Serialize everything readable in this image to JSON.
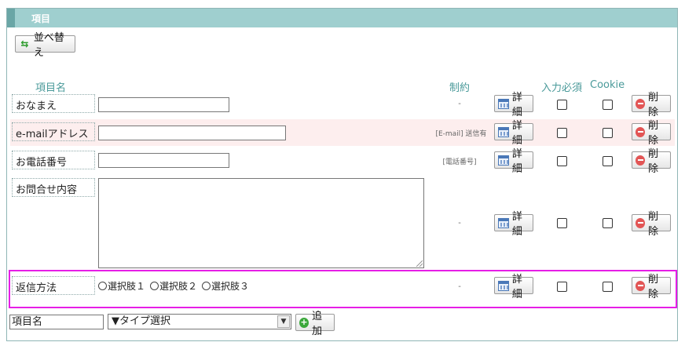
{
  "panel": {
    "title": "項目"
  },
  "toolbar": {
    "sort_label": "並べ替え"
  },
  "columns": {
    "name": "項目名",
    "constraint": "制約",
    "required": "入力必須",
    "cookie": "Cookie"
  },
  "rows": [
    {
      "label": "おなまえ",
      "constraint": "-"
    },
    {
      "label": "e-mailアドレス",
      "constraint": "[E-mail] 送信有"
    },
    {
      "label": "お電話番号",
      "constraint": "[電話番号]"
    },
    {
      "label": "お問合せ内容",
      "constraint": "-"
    },
    {
      "label": "返信方法",
      "constraint": "-",
      "options": [
        "選択肢１",
        "選択肢２",
        "選択肢３"
      ]
    }
  ],
  "actions": {
    "detail_label": "詳細",
    "delete_label": "削除"
  },
  "add_form": {
    "name_value": "項目名",
    "type_selected": "▼タイプ選択",
    "add_label": "追加"
  },
  "colors": {
    "header": "#9fcfcf",
    "highlight": "#e61ee6",
    "accent_text": "#4a9a9a"
  }
}
